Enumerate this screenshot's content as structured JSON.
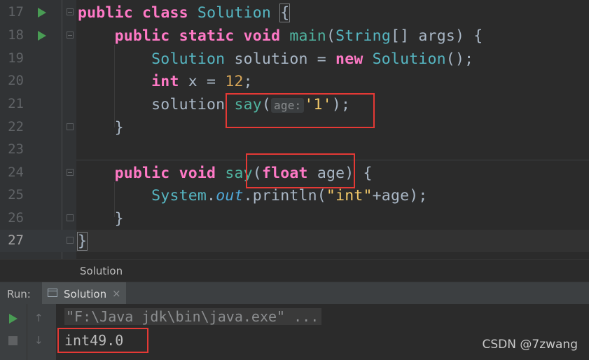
{
  "editor": {
    "line_numbers": [
      "17",
      "18",
      "19",
      "20",
      "21",
      "22",
      "23",
      "24",
      "25",
      "26",
      "27"
    ],
    "code": {
      "l17": {
        "kw1": "public",
        "kw2": "class",
        "cls": "Solution",
        "brace": "{"
      },
      "l18": {
        "kw1": "public",
        "kw2": "static",
        "kw3": "void",
        "fn": "main",
        "p1": "(",
        "type": "String",
        "rest": "[] args) {"
      },
      "l19": {
        "cls": "Solution",
        "var": " solution = ",
        "kw": "new",
        "cls2": "Solution",
        "end": "();"
      },
      "l20": {
        "kw": "int",
        "rest": " x = ",
        "num": "12",
        "end": ";"
      },
      "l21": {
        "obj": "solution ",
        "fn": "say",
        "p": "(",
        "hint": "age:",
        "str": "'1'",
        "end": ");"
      },
      "l22": {
        "text": "}"
      },
      "l24": {
        "kw1": "public",
        "kw2": "void",
        "fn": "say",
        "p": "(",
        "kw3": "float",
        "rest": " age)",
        "end": " {"
      },
      "l25": {
        "cls": "System",
        "dot": ".",
        "fld": "out",
        "call": ".println(",
        "str": "\"int\"",
        "end": "+age);"
      },
      "l26": {
        "text": "}"
      },
      "l27": {
        "text": "}"
      }
    }
  },
  "breadcrumb": {
    "item": "Solution"
  },
  "run_panel": {
    "label": "Run:",
    "tab_label": "Solution",
    "tab_close": "×",
    "up_arrow": "↑",
    "down_arrow": "↓",
    "command": "\"F:\\Java jdk\\bin\\java.exe\" ...",
    "output": "int49.0"
  },
  "watermark": "CSDN @7zwang",
  "icons": [
    "run-gutter-icon",
    "fold-icon",
    "console-window-icon",
    "play-icon",
    "stop-icon"
  ],
  "colors": {
    "highlight_box": "#e53935",
    "keyword": "#ff79c6",
    "class": "#56b6c2",
    "string": "#f3c969",
    "number": "#d8a657"
  }
}
